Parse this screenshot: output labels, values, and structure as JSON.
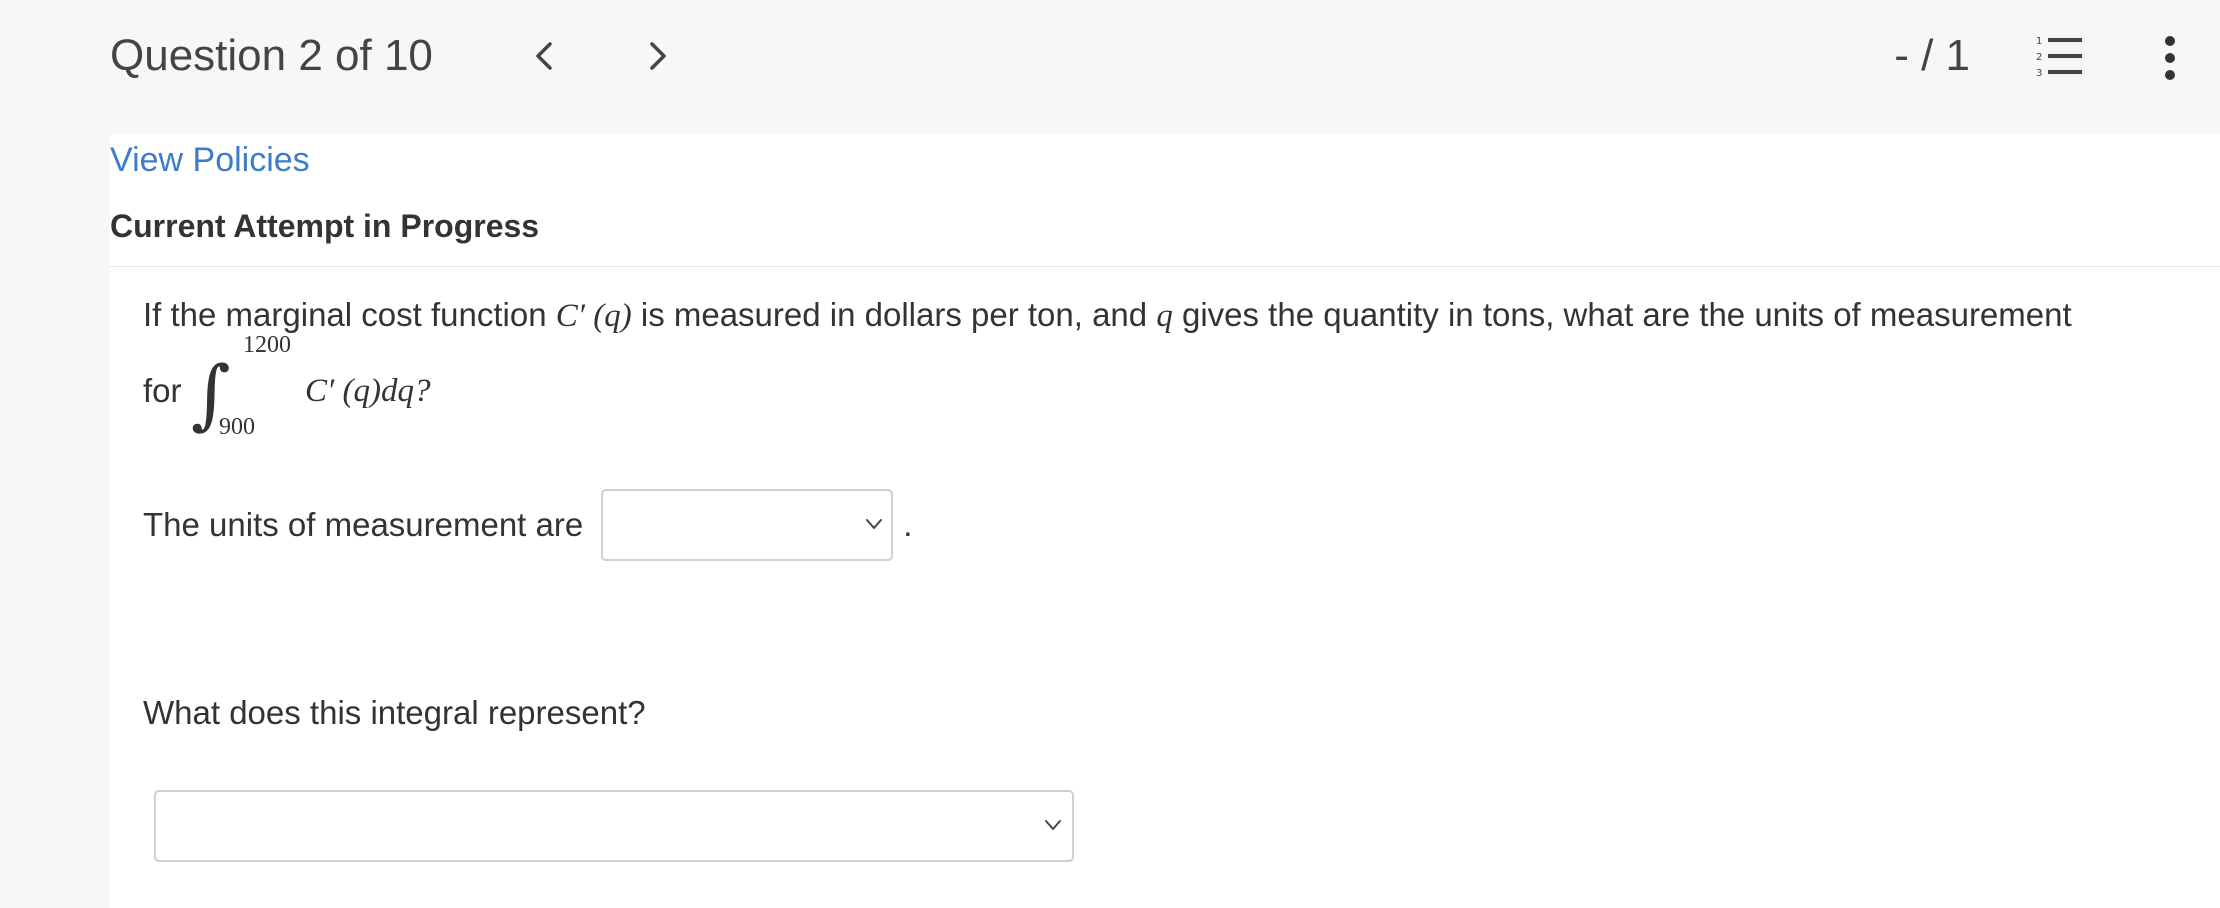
{
  "header": {
    "question_counter": "Question 2 of 10",
    "score": "- / 1",
    "prev_icon": "chevron-left-icon",
    "next_icon": "chevron-right-icon",
    "list_icon": "numbered-list-icon",
    "more_icon": "more-vertical-icon"
  },
  "links": {
    "view_policies": "View Policies"
  },
  "attempt": {
    "heading": "Current Attempt in Progress"
  },
  "question": {
    "text_before_c": "If the marginal cost function ",
    "c_prime": "C′",
    "c_arg": " (q)",
    "text_mid": " is measured in dollars per ton, and ",
    "q_var": "q",
    "text_after": " gives the quantity in tons, what are the units of measurement",
    "for_word": "for",
    "integral_upper": "1200",
    "integral_lower": "900",
    "integrand": "C′ (q)dq?"
  },
  "units": {
    "label": "The units of measurement are",
    "selected": "",
    "trailing": "."
  },
  "represent": {
    "label": "What does this integral represent?",
    "selected": ""
  },
  "colors": {
    "link": "#3d7cc9",
    "header_bg": "#f7f7f7",
    "text": "#333333",
    "border": "#cfcfcf"
  }
}
